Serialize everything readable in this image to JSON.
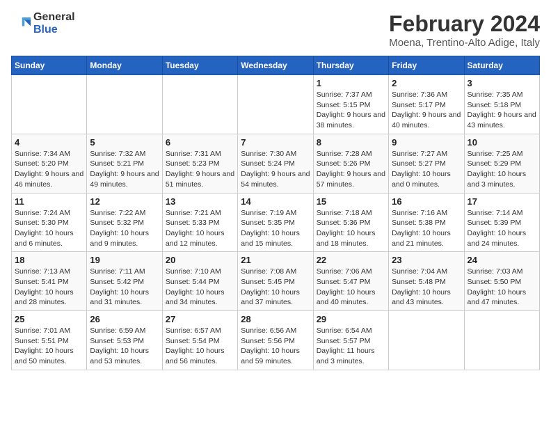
{
  "logo": {
    "line1": "General",
    "line2": "Blue"
  },
  "title": "February 2024",
  "subtitle": "Moena, Trentino-Alto Adige, Italy",
  "days_of_week": [
    "Sunday",
    "Monday",
    "Tuesday",
    "Wednesday",
    "Thursday",
    "Friday",
    "Saturday"
  ],
  "weeks": [
    [
      {
        "num": "",
        "sunrise": "",
        "sunset": "",
        "daylight": ""
      },
      {
        "num": "",
        "sunrise": "",
        "sunset": "",
        "daylight": ""
      },
      {
        "num": "",
        "sunrise": "",
        "sunset": "",
        "daylight": ""
      },
      {
        "num": "",
        "sunrise": "",
        "sunset": "",
        "daylight": ""
      },
      {
        "num": "1",
        "sunrise": "Sunrise: 7:37 AM",
        "sunset": "Sunset: 5:15 PM",
        "daylight": "Daylight: 9 hours and 38 minutes."
      },
      {
        "num": "2",
        "sunrise": "Sunrise: 7:36 AM",
        "sunset": "Sunset: 5:17 PM",
        "daylight": "Daylight: 9 hours and 40 minutes."
      },
      {
        "num": "3",
        "sunrise": "Sunrise: 7:35 AM",
        "sunset": "Sunset: 5:18 PM",
        "daylight": "Daylight: 9 hours and 43 minutes."
      }
    ],
    [
      {
        "num": "4",
        "sunrise": "Sunrise: 7:34 AM",
        "sunset": "Sunset: 5:20 PM",
        "daylight": "Daylight: 9 hours and 46 minutes."
      },
      {
        "num": "5",
        "sunrise": "Sunrise: 7:32 AM",
        "sunset": "Sunset: 5:21 PM",
        "daylight": "Daylight: 9 hours and 49 minutes."
      },
      {
        "num": "6",
        "sunrise": "Sunrise: 7:31 AM",
        "sunset": "Sunset: 5:23 PM",
        "daylight": "Daylight: 9 hours and 51 minutes."
      },
      {
        "num": "7",
        "sunrise": "Sunrise: 7:30 AM",
        "sunset": "Sunset: 5:24 PM",
        "daylight": "Daylight: 9 hours and 54 minutes."
      },
      {
        "num": "8",
        "sunrise": "Sunrise: 7:28 AM",
        "sunset": "Sunset: 5:26 PM",
        "daylight": "Daylight: 9 hours and 57 minutes."
      },
      {
        "num": "9",
        "sunrise": "Sunrise: 7:27 AM",
        "sunset": "Sunset: 5:27 PM",
        "daylight": "Daylight: 10 hours and 0 minutes."
      },
      {
        "num": "10",
        "sunrise": "Sunrise: 7:25 AM",
        "sunset": "Sunset: 5:29 PM",
        "daylight": "Daylight: 10 hours and 3 minutes."
      }
    ],
    [
      {
        "num": "11",
        "sunrise": "Sunrise: 7:24 AM",
        "sunset": "Sunset: 5:30 PM",
        "daylight": "Daylight: 10 hours and 6 minutes."
      },
      {
        "num": "12",
        "sunrise": "Sunrise: 7:22 AM",
        "sunset": "Sunset: 5:32 PM",
        "daylight": "Daylight: 10 hours and 9 minutes."
      },
      {
        "num": "13",
        "sunrise": "Sunrise: 7:21 AM",
        "sunset": "Sunset: 5:33 PM",
        "daylight": "Daylight: 10 hours and 12 minutes."
      },
      {
        "num": "14",
        "sunrise": "Sunrise: 7:19 AM",
        "sunset": "Sunset: 5:35 PM",
        "daylight": "Daylight: 10 hours and 15 minutes."
      },
      {
        "num": "15",
        "sunrise": "Sunrise: 7:18 AM",
        "sunset": "Sunset: 5:36 PM",
        "daylight": "Daylight: 10 hours and 18 minutes."
      },
      {
        "num": "16",
        "sunrise": "Sunrise: 7:16 AM",
        "sunset": "Sunset: 5:38 PM",
        "daylight": "Daylight: 10 hours and 21 minutes."
      },
      {
        "num": "17",
        "sunrise": "Sunrise: 7:14 AM",
        "sunset": "Sunset: 5:39 PM",
        "daylight": "Daylight: 10 hours and 24 minutes."
      }
    ],
    [
      {
        "num": "18",
        "sunrise": "Sunrise: 7:13 AM",
        "sunset": "Sunset: 5:41 PM",
        "daylight": "Daylight: 10 hours and 28 minutes."
      },
      {
        "num": "19",
        "sunrise": "Sunrise: 7:11 AM",
        "sunset": "Sunset: 5:42 PM",
        "daylight": "Daylight: 10 hours and 31 minutes."
      },
      {
        "num": "20",
        "sunrise": "Sunrise: 7:10 AM",
        "sunset": "Sunset: 5:44 PM",
        "daylight": "Daylight: 10 hours and 34 minutes."
      },
      {
        "num": "21",
        "sunrise": "Sunrise: 7:08 AM",
        "sunset": "Sunset: 5:45 PM",
        "daylight": "Daylight: 10 hours and 37 minutes."
      },
      {
        "num": "22",
        "sunrise": "Sunrise: 7:06 AM",
        "sunset": "Sunset: 5:47 PM",
        "daylight": "Daylight: 10 hours and 40 minutes."
      },
      {
        "num": "23",
        "sunrise": "Sunrise: 7:04 AM",
        "sunset": "Sunset: 5:48 PM",
        "daylight": "Daylight: 10 hours and 43 minutes."
      },
      {
        "num": "24",
        "sunrise": "Sunrise: 7:03 AM",
        "sunset": "Sunset: 5:50 PM",
        "daylight": "Daylight: 10 hours and 47 minutes."
      }
    ],
    [
      {
        "num": "25",
        "sunrise": "Sunrise: 7:01 AM",
        "sunset": "Sunset: 5:51 PM",
        "daylight": "Daylight: 10 hours and 50 minutes."
      },
      {
        "num": "26",
        "sunrise": "Sunrise: 6:59 AM",
        "sunset": "Sunset: 5:53 PM",
        "daylight": "Daylight: 10 hours and 53 minutes."
      },
      {
        "num": "27",
        "sunrise": "Sunrise: 6:57 AM",
        "sunset": "Sunset: 5:54 PM",
        "daylight": "Daylight: 10 hours and 56 minutes."
      },
      {
        "num": "28",
        "sunrise": "Sunrise: 6:56 AM",
        "sunset": "Sunset: 5:56 PM",
        "daylight": "Daylight: 10 hours and 59 minutes."
      },
      {
        "num": "29",
        "sunrise": "Sunrise: 6:54 AM",
        "sunset": "Sunset: 5:57 PM",
        "daylight": "Daylight: 11 hours and 3 minutes."
      },
      {
        "num": "",
        "sunrise": "",
        "sunset": "",
        "daylight": ""
      },
      {
        "num": "",
        "sunrise": "",
        "sunset": "",
        "daylight": ""
      }
    ]
  ]
}
